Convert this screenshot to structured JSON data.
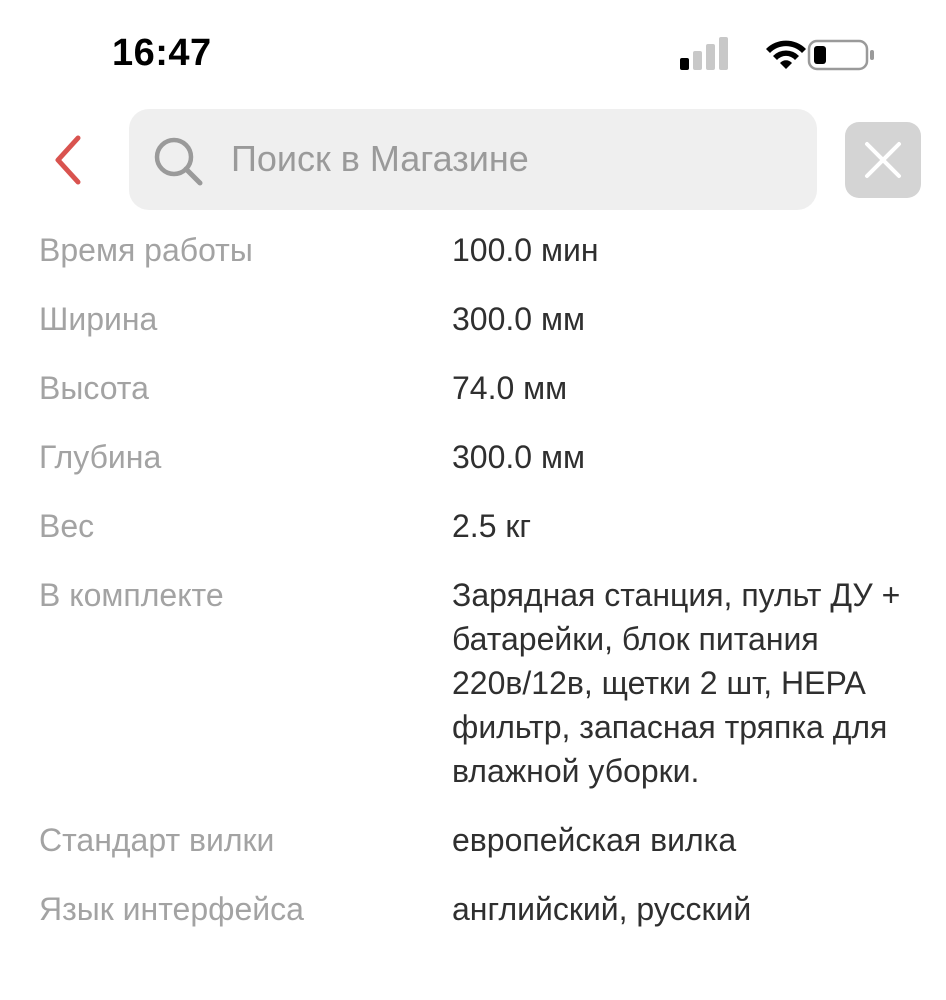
{
  "status_bar": {
    "time": "16:47"
  },
  "header": {
    "search": {
      "placeholder": "Поиск в Магазине",
      "value": ""
    }
  },
  "specs": [
    {
      "label": "Время работы",
      "value": "100.0 мин"
    },
    {
      "label": "Ширина",
      "value": "300.0 мм"
    },
    {
      "label": "Высота",
      "value": "74.0 мм"
    },
    {
      "label": "Глубина",
      "value": "300.0 мм"
    },
    {
      "label": "Вес",
      "value": "2.5 кг"
    },
    {
      "label": "В комплекте",
      "value": "Зарядная станция, пульт ДУ + батарейки, блок питания 220в/12в, щетки 2 шт, HEPA фильтр, запасная тряпка для влажной уборки."
    },
    {
      "label": "Стандарт вилки",
      "value": "европейская вилка"
    },
    {
      "label": "Язык интерфейса",
      "value": "английский, русский"
    }
  ],
  "colors": {
    "accent": "#d9534f",
    "label": "#a3a3a3",
    "value": "#2f2f2f",
    "search_bg": "#efefef",
    "clear_bg": "#d4d4d4"
  },
  "icons": {
    "back": "chevron-left-icon",
    "search": "search-icon",
    "clear": "close-icon",
    "signal": "cellular-signal-icon",
    "wifi": "wifi-icon",
    "battery": "battery-icon"
  }
}
